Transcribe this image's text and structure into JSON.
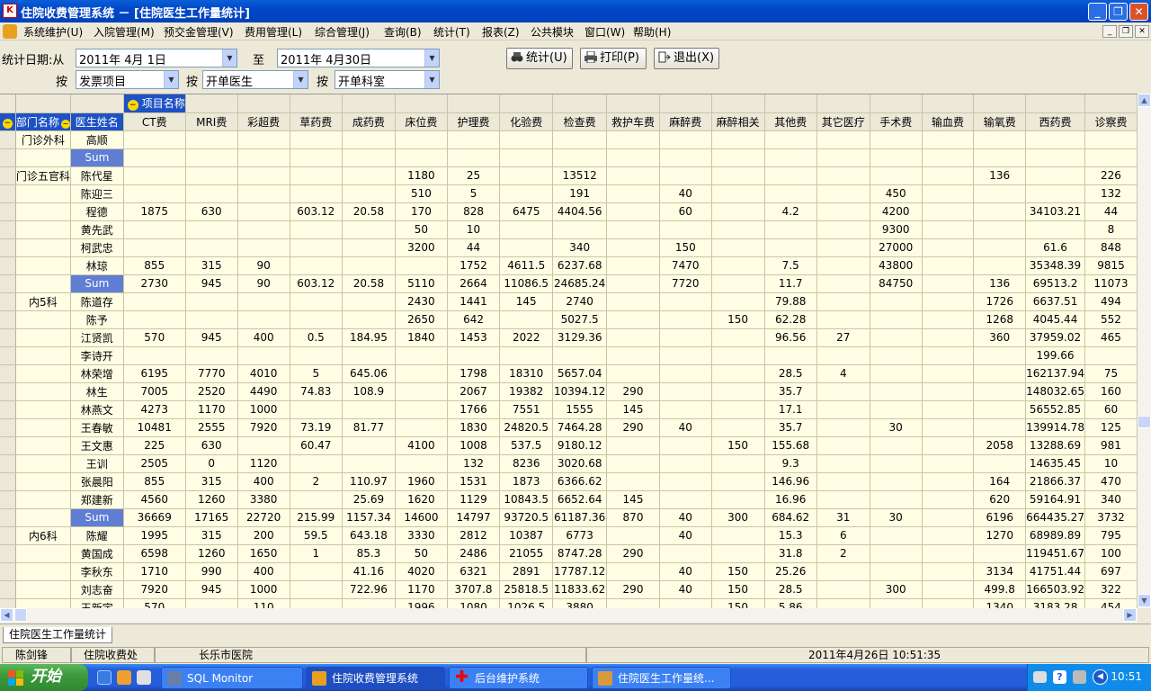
{
  "window": {
    "title": "住院收费管理系统 － [住院医生工作量统计]",
    "app_icon_glyph": "K"
  },
  "menu": [
    "系统维护(U)",
    "入院管理(M)",
    "预交金管理(V)",
    "费用管理(L)",
    "综合管理(J)",
    "查询(B)",
    "统计(T)",
    "报表(Z)",
    "公共模块",
    "窗口(W)",
    "帮助(H)"
  ],
  "filter": {
    "date_label": "统计日期:从",
    "date_from": "2011年  4月  1日",
    "to_label": "至",
    "date_to": "2011年  4月30日",
    "by_label": "按",
    "group1": "发票项目",
    "group2": "开单医生",
    "group3": "开单科室"
  },
  "toolbar": {
    "stat": "统计(U)",
    "print": "打印(P)",
    "exit": "退出(X)"
  },
  "grid": {
    "pivot_field": "项目名称",
    "row_fields": [
      "部门名称",
      "医生姓名"
    ],
    "columns": [
      "CT费",
      "MRI费",
      "彩超费",
      "草药费",
      "成药费",
      "床位费",
      "护理费",
      "化验费",
      "检查费",
      "救护车费",
      "麻醉费",
      "麻醉相关",
      "其他费",
      "其它医疗",
      "手术费",
      "输血费",
      "输氧费",
      "西药费",
      "诊察费"
    ],
    "rows": [
      {
        "dept": "门诊外科",
        "doctor": "高顺",
        "values": [
          "",
          "",
          "",
          "",
          "",
          "",
          "",
          "",
          "",
          "",
          "",
          "",
          "",
          "",
          "",
          "",
          "",
          "",
          ""
        ]
      },
      {
        "dept": "",
        "doctor": "Sum",
        "sum": true,
        "values": [
          "",
          "",
          "",
          "",
          "",
          "",
          "",
          "",
          "",
          "",
          "",
          "",
          "",
          "",
          "",
          "",
          "",
          "",
          ""
        ]
      },
      {
        "dept": "门诊五官科",
        "doctor": "陈代星",
        "values": [
          "",
          "",
          "",
          "",
          "",
          "1180",
          "25",
          "",
          "13512",
          "",
          "",
          "",
          "",
          "",
          "",
          "",
          "136",
          "",
          "226"
        ]
      },
      {
        "dept": "",
        "doctor": "陈迎三",
        "values": [
          "",
          "",
          "",
          "",
          "",
          "510",
          "5",
          "",
          "191",
          "",
          "40",
          "",
          "",
          "",
          "450",
          "",
          "",
          "",
          "132"
        ]
      },
      {
        "dept": "",
        "doctor": "程德",
        "values": [
          "1875",
          "630",
          "",
          "603.12",
          "20.58",
          "170",
          "828",
          "6475",
          "4404.56",
          "",
          "60",
          "",
          "4.2",
          "",
          "4200",
          "",
          "",
          "34103.21",
          "44"
        ]
      },
      {
        "dept": "",
        "doctor": "黄先武",
        "values": [
          "",
          "",
          "",
          "",
          "",
          "50",
          "10",
          "",
          "",
          "",
          "",
          "",
          "",
          "",
          "9300",
          "",
          "",
          "",
          "8"
        ]
      },
      {
        "dept": "",
        "doctor": "柯武忠",
        "values": [
          "",
          "",
          "",
          "",
          "",
          "3200",
          "44",
          "",
          "340",
          "",
          "150",
          "",
          "",
          "",
          "27000",
          "",
          "",
          "61.6",
          "848"
        ]
      },
      {
        "dept": "",
        "doctor": "林琼",
        "values": [
          "855",
          "315",
          "90",
          "",
          "",
          "",
          "1752",
          "4611.5",
          "6237.68",
          "",
          "7470",
          "",
          "7.5",
          "",
          "43800",
          "",
          "",
          "35348.39",
          "9815"
        ]
      },
      {
        "dept": "",
        "doctor": "Sum",
        "sum": true,
        "values": [
          "2730",
          "945",
          "90",
          "603.12",
          "20.58",
          "5110",
          "2664",
          "11086.5",
          "24685.24",
          "",
          "7720",
          "",
          "11.7",
          "",
          "84750",
          "",
          "136",
          "69513.2",
          "11073"
        ]
      },
      {
        "dept": "内5科",
        "doctor": "陈道存",
        "values": [
          "",
          "",
          "",
          "",
          "",
          "2430",
          "1441",
          "145",
          "2740",
          "",
          "",
          "",
          "79.88",
          "",
          "",
          "",
          "1726",
          "6637.51",
          "494"
        ]
      },
      {
        "dept": "",
        "doctor": "陈予",
        "values": [
          "",
          "",
          "",
          "",
          "",
          "2650",
          "642",
          "",
          "5027.5",
          "",
          "",
          "150",
          "62.28",
          "",
          "",
          "",
          "1268",
          "4045.44",
          "552"
        ]
      },
      {
        "dept": "",
        "doctor": "江贤凯",
        "values": [
          "570",
          "945",
          "400",
          "0.5",
          "184.95",
          "1840",
          "1453",
          "2022",
          "3129.36",
          "",
          "",
          "",
          "96.56",
          "27",
          "",
          "",
          "360",
          "37959.02",
          "465"
        ]
      },
      {
        "dept": "",
        "doctor": "李诗开",
        "values": [
          "",
          "",
          "",
          "",
          "",
          "",
          "",
          "",
          "",
          "",
          "",
          "",
          "",
          "",
          "",
          "",
          "",
          "199.66",
          ""
        ]
      },
      {
        "dept": "",
        "doctor": "林荣增",
        "values": [
          "6195",
          "7770",
          "4010",
          "5",
          "645.06",
          "",
          "1798",
          "18310",
          "5657.04",
          "",
          "",
          "",
          "28.5",
          "4",
          "",
          "",
          "",
          "162137.94",
          "75"
        ]
      },
      {
        "dept": "",
        "doctor": "林生",
        "values": [
          "7005",
          "2520",
          "4490",
          "74.83",
          "108.9",
          "",
          "2067",
          "19382",
          "10394.12",
          "290",
          "",
          "",
          "35.7",
          "",
          "",
          "",
          "",
          "148032.65",
          "160"
        ]
      },
      {
        "dept": "",
        "doctor": "林燕文",
        "values": [
          "4273",
          "1170",
          "1000",
          "",
          "",
          "",
          "1766",
          "7551",
          "1555",
          "145",
          "",
          "",
          "17.1",
          "",
          "",
          "",
          "",
          "56552.85",
          "60"
        ]
      },
      {
        "dept": "",
        "doctor": "王春敏",
        "values": [
          "10481",
          "2555",
          "7920",
          "73.19",
          "81.77",
          "",
          "1830",
          "24820.5",
          "7464.28",
          "290",
          "40",
          "",
          "35.7",
          "",
          "30",
          "",
          "",
          "139914.78",
          "125"
        ]
      },
      {
        "dept": "",
        "doctor": "王文惠",
        "values": [
          "225",
          "630",
          "",
          "60.47",
          "",
          "4100",
          "1008",
          "537.5",
          "9180.12",
          "",
          "",
          "150",
          "155.68",
          "",
          "",
          "",
          "2058",
          "13288.69",
          "981"
        ]
      },
      {
        "dept": "",
        "doctor": "王训",
        "values": [
          "2505",
          "0",
          "1120",
          "",
          "",
          "",
          "132",
          "8236",
          "3020.68",
          "",
          "",
          "",
          "9.3",
          "",
          "",
          "",
          "",
          "14635.45",
          "10"
        ]
      },
      {
        "dept": "",
        "doctor": "张晨阳",
        "values": [
          "855",
          "315",
          "400",
          "2",
          "110.97",
          "1960",
          "1531",
          "1873",
          "6366.62",
          "",
          "",
          "",
          "146.96",
          "",
          "",
          "",
          "164",
          "21866.37",
          "470"
        ]
      },
      {
        "dept": "",
        "doctor": "郑建新",
        "values": [
          "4560",
          "1260",
          "3380",
          "",
          "25.69",
          "1620",
          "1129",
          "10843.5",
          "6652.64",
          "145",
          "",
          "",
          "16.96",
          "",
          "",
          "",
          "620",
          "59164.91",
          "340"
        ]
      },
      {
        "dept": "",
        "doctor": "Sum",
        "sum": true,
        "values": [
          "36669",
          "17165",
          "22720",
          "215.99",
          "1157.34",
          "14600",
          "14797",
          "93720.5",
          "61187.36",
          "870",
          "40",
          "300",
          "684.62",
          "31",
          "30",
          "",
          "6196",
          "664435.27",
          "3732"
        ]
      },
      {
        "dept": "内6科",
        "doctor": "陈耀",
        "values": [
          "1995",
          "315",
          "200",
          "59.5",
          "643.18",
          "3330",
          "2812",
          "10387",
          "6773",
          "",
          "40",
          "",
          "15.3",
          "6",
          "",
          "",
          "1270",
          "68989.89",
          "795"
        ]
      },
      {
        "dept": "",
        "doctor": "黄国成",
        "values": [
          "6598",
          "1260",
          "1650",
          "1",
          "85.3",
          "50",
          "2486",
          "21055",
          "8747.28",
          "290",
          "",
          "",
          "31.8",
          "2",
          "",
          "",
          "",
          "119451.67",
          "100"
        ]
      },
      {
        "dept": "",
        "doctor": "李秋东",
        "values": [
          "1710",
          "990",
          "400",
          "",
          "41.16",
          "4020",
          "6321",
          "2891",
          "17787.12",
          "",
          "40",
          "150",
          "25.26",
          "",
          "",
          "",
          "3134",
          "41751.44",
          "697"
        ]
      },
      {
        "dept": "",
        "doctor": "刘志奋",
        "values": [
          "7920",
          "945",
          "1000",
          "",
          "722.96",
          "1170",
          "3707.8",
          "25818.5",
          "11833.62",
          "290",
          "40",
          "150",
          "28.5",
          "",
          "300",
          "",
          "499.8",
          "166503.92",
          "322"
        ]
      },
      {
        "dept": "",
        "doctor": "王新宇",
        "values": [
          "570",
          "",
          "110",
          "",
          "",
          "1996",
          "1080",
          "1026.5",
          "3880",
          "",
          "",
          "150",
          "5.86",
          "",
          "",
          "",
          "1340",
          "3183.28",
          "454"
        ]
      }
    ]
  },
  "tab": "住院医生工作量统计",
  "status": {
    "user": "陈剑锋",
    "dept": "住院收费处",
    "hospital": "长乐市医院",
    "datetime": "2011年4月26日  10:51:35"
  },
  "taskbar": {
    "start": "开始",
    "items": [
      "SQL Monitor",
      "住院收费管理系统",
      "后台维护系统",
      "住院医生工作量统..."
    ],
    "clock": "10:51"
  }
}
